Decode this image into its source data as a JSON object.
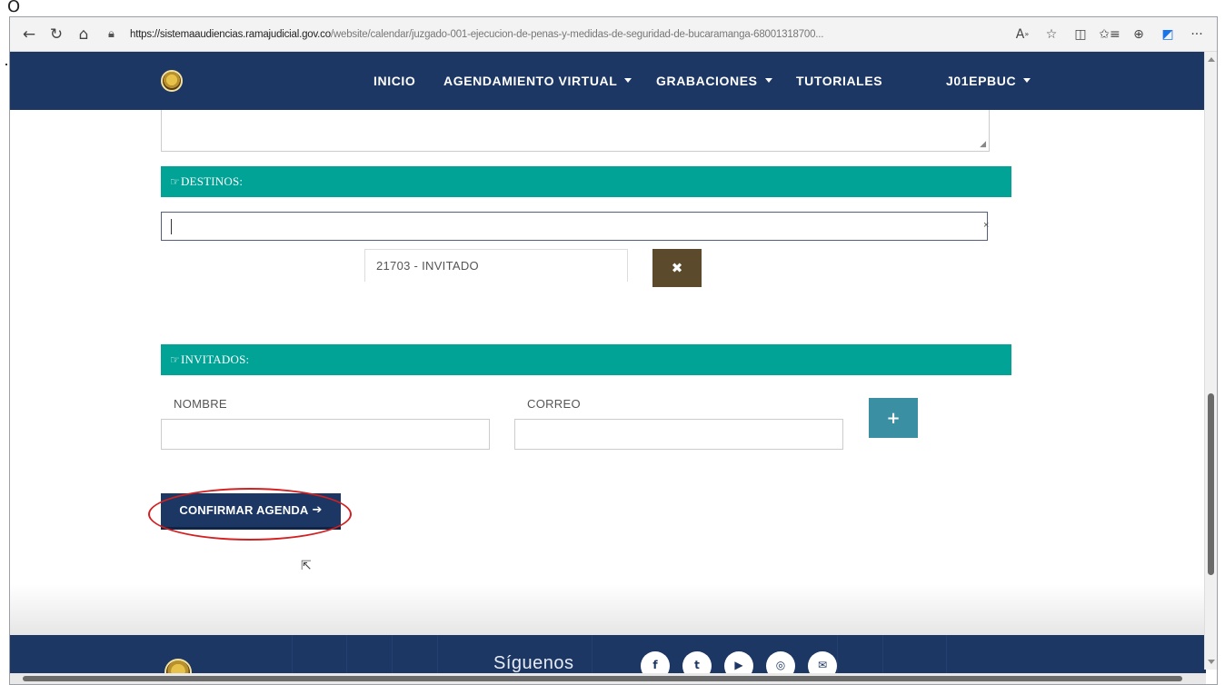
{
  "stray_char": "O",
  "browser": {
    "url_prefix": "https://sistemaaudiencias.ramajudicial.gov.co",
    "url_rest": "/website/calendar/juzgado-001-ejecucion-de-penas-y-medidas-de-seguridad-de-bucaramanga-68001318700...",
    "icons": [
      "back-arrow-icon",
      "refresh-icon",
      "home-icon",
      "lock-icon",
      "read-aloud-icon",
      "favorite-star-icon",
      "split-screen-icon",
      "favorites-list-icon",
      "collections-icon",
      "edge-copilot-icon",
      "more-menu-icon"
    ],
    "accent": "#1a73e8"
  },
  "nav": {
    "items": [
      {
        "label": "INICIO",
        "dropdown": false
      },
      {
        "label": "AGENDAMIENTO VIRTUAL",
        "dropdown": true
      },
      {
        "label": "GRABACIONES",
        "dropdown": true
      },
      {
        "label": "TUTORIALES",
        "dropdown": false
      },
      {
        "label": "J01EPBUC",
        "dropdown": true
      }
    ],
    "bg_color": "#1c3764"
  },
  "form": {
    "destinos": {
      "title": "DESTINOS:",
      "input_value": "",
      "clear_glyph": "×",
      "selected_tag": "21703 - INVITADO",
      "remove_glyph": "✖"
    },
    "invitados": {
      "title": "INVITADOS:",
      "name_label": "NOMBRE",
      "name_value": "",
      "email_label": "CORREO",
      "email_value": "",
      "add_glyph": "+"
    },
    "confirm_label": "CONFIRMAR AGENDA",
    "confirm_arrow": "➔",
    "section_color": "#00a396"
  },
  "annotation": {
    "color": "#d32020"
  },
  "footer": {
    "follow_text": "Síguenos",
    "social": [
      {
        "icon": "facebook-icon",
        "glyph": "f"
      },
      {
        "icon": "twitter-icon",
        "glyph": "t"
      },
      {
        "icon": "youtube-icon",
        "glyph": "▶"
      },
      {
        "icon": "instagram-icon",
        "glyph": "◎"
      },
      {
        "icon": "email-icon",
        "glyph": "✉"
      }
    ]
  }
}
